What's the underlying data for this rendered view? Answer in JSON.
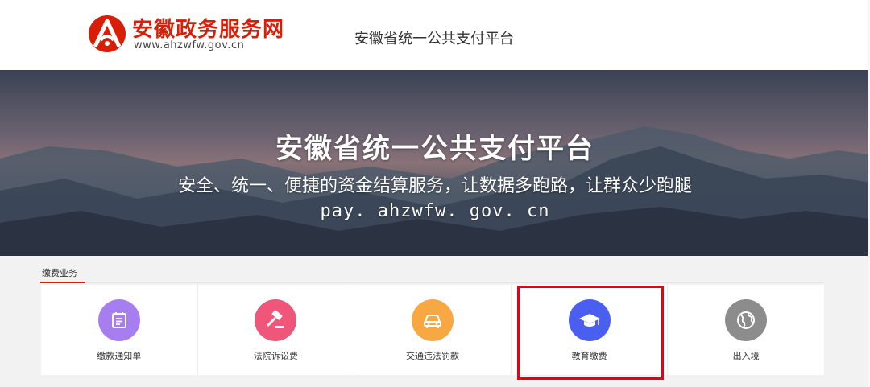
{
  "header": {
    "site_name": "安徽政务服务网",
    "site_url": "www.ahzwfw.gov.cn",
    "platform_name": "安徽省统一公共支付平台"
  },
  "banner": {
    "title": "安徽省统一公共支付平台",
    "subtitle": "安全、统一、便捷的资金结算服务，让数据多跑路，让群众少跑腿",
    "url": "pay. ahzwfw. gov. cn"
  },
  "section": {
    "tab_label": "缴费业务"
  },
  "services": [
    {
      "label": "缴款通知单",
      "icon": "notice-icon",
      "color": "#a77ef0"
    },
    {
      "label": "法院诉讼费",
      "icon": "gavel-icon",
      "color": "#f0567a"
    },
    {
      "label": "交通违法罚款",
      "icon": "car-icon",
      "color": "#f7a843"
    },
    {
      "label": "教育缴费",
      "icon": "graduation-cap-icon",
      "color": "#4a5ff0"
    },
    {
      "label": "出入境",
      "icon": "globe-icon",
      "color": "#8c8c8c"
    }
  ],
  "colors": {
    "brand_red": "#d81e06",
    "highlight_red": "#e60012"
  }
}
